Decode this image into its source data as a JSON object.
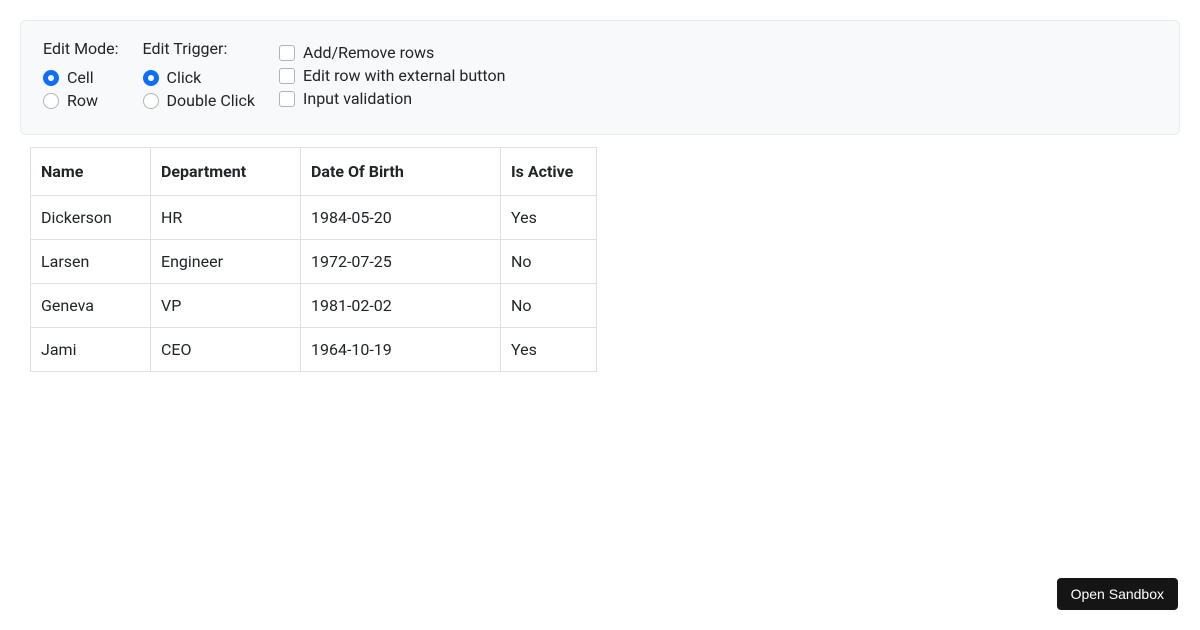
{
  "options": {
    "editMode": {
      "title": "Edit Mode:",
      "items": [
        {
          "label": "Cell",
          "checked": true
        },
        {
          "label": "Row",
          "checked": false
        }
      ]
    },
    "editTrigger": {
      "title": "Edit Trigger:",
      "items": [
        {
          "label": "Click",
          "checked": true
        },
        {
          "label": "Double Click",
          "checked": false
        }
      ]
    },
    "extras": {
      "items": [
        {
          "label": "Add/Remove rows",
          "checked": false
        },
        {
          "label": "Edit row with external button",
          "checked": false
        },
        {
          "label": "Input validation",
          "checked": false
        }
      ]
    }
  },
  "table": {
    "columns": [
      "Name",
      "Department",
      "Date Of Birth",
      "Is Active"
    ],
    "rows": [
      {
        "name": "Dickerson",
        "department": "HR",
        "dob": "1984-05-20",
        "active": "Yes"
      },
      {
        "name": "Larsen",
        "department": "Engineer",
        "dob": "1972-07-25",
        "active": "No"
      },
      {
        "name": "Geneva",
        "department": "VP",
        "dob": "1981-02-02",
        "active": "No"
      },
      {
        "name": "Jami",
        "department": "CEO",
        "dob": "1964-10-19",
        "active": "Yes"
      }
    ]
  },
  "openSandbox": {
    "label": "Open Sandbox"
  }
}
